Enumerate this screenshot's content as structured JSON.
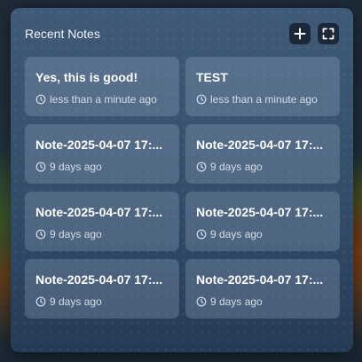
{
  "widget": {
    "title": "Recent Notes",
    "actions": [
      {
        "icon": "plus-icon",
        "label": "Add note"
      },
      {
        "icon": "expand-icon",
        "label": "Expand"
      }
    ]
  },
  "notes": [
    {
      "title": "Yes, this is good!",
      "time": "less than a minute ago",
      "icon": "clock-icon"
    },
    {
      "title": "TEST",
      "time": "less than a minute ago",
      "icon": "clock-icon"
    },
    {
      "title": "Note-2025-04-07 17:...",
      "time": "9 days ago",
      "icon": "clock-icon"
    },
    {
      "title": "Note-2025-04-07 17:...",
      "time": "9 days ago",
      "icon": "clock-icon"
    },
    {
      "title": "Note-2025-04-07 17:...",
      "time": "9 days ago",
      "icon": "clock-icon"
    },
    {
      "title": "Note-2025-04-07 17:...",
      "time": "9 days ago",
      "icon": "clock-icon"
    },
    {
      "title": "Note-2025-04-07 17:...",
      "time": "9 days ago",
      "icon": "clock-icon"
    },
    {
      "title": "Note-2025-04-07 17:...",
      "time": "9 days ago",
      "icon": "clock-icon"
    }
  ],
  "colors": {
    "panel": "#36506c",
    "card": "#6f839c",
    "icon_button": "#1c2738",
    "text": "#ffffff"
  }
}
